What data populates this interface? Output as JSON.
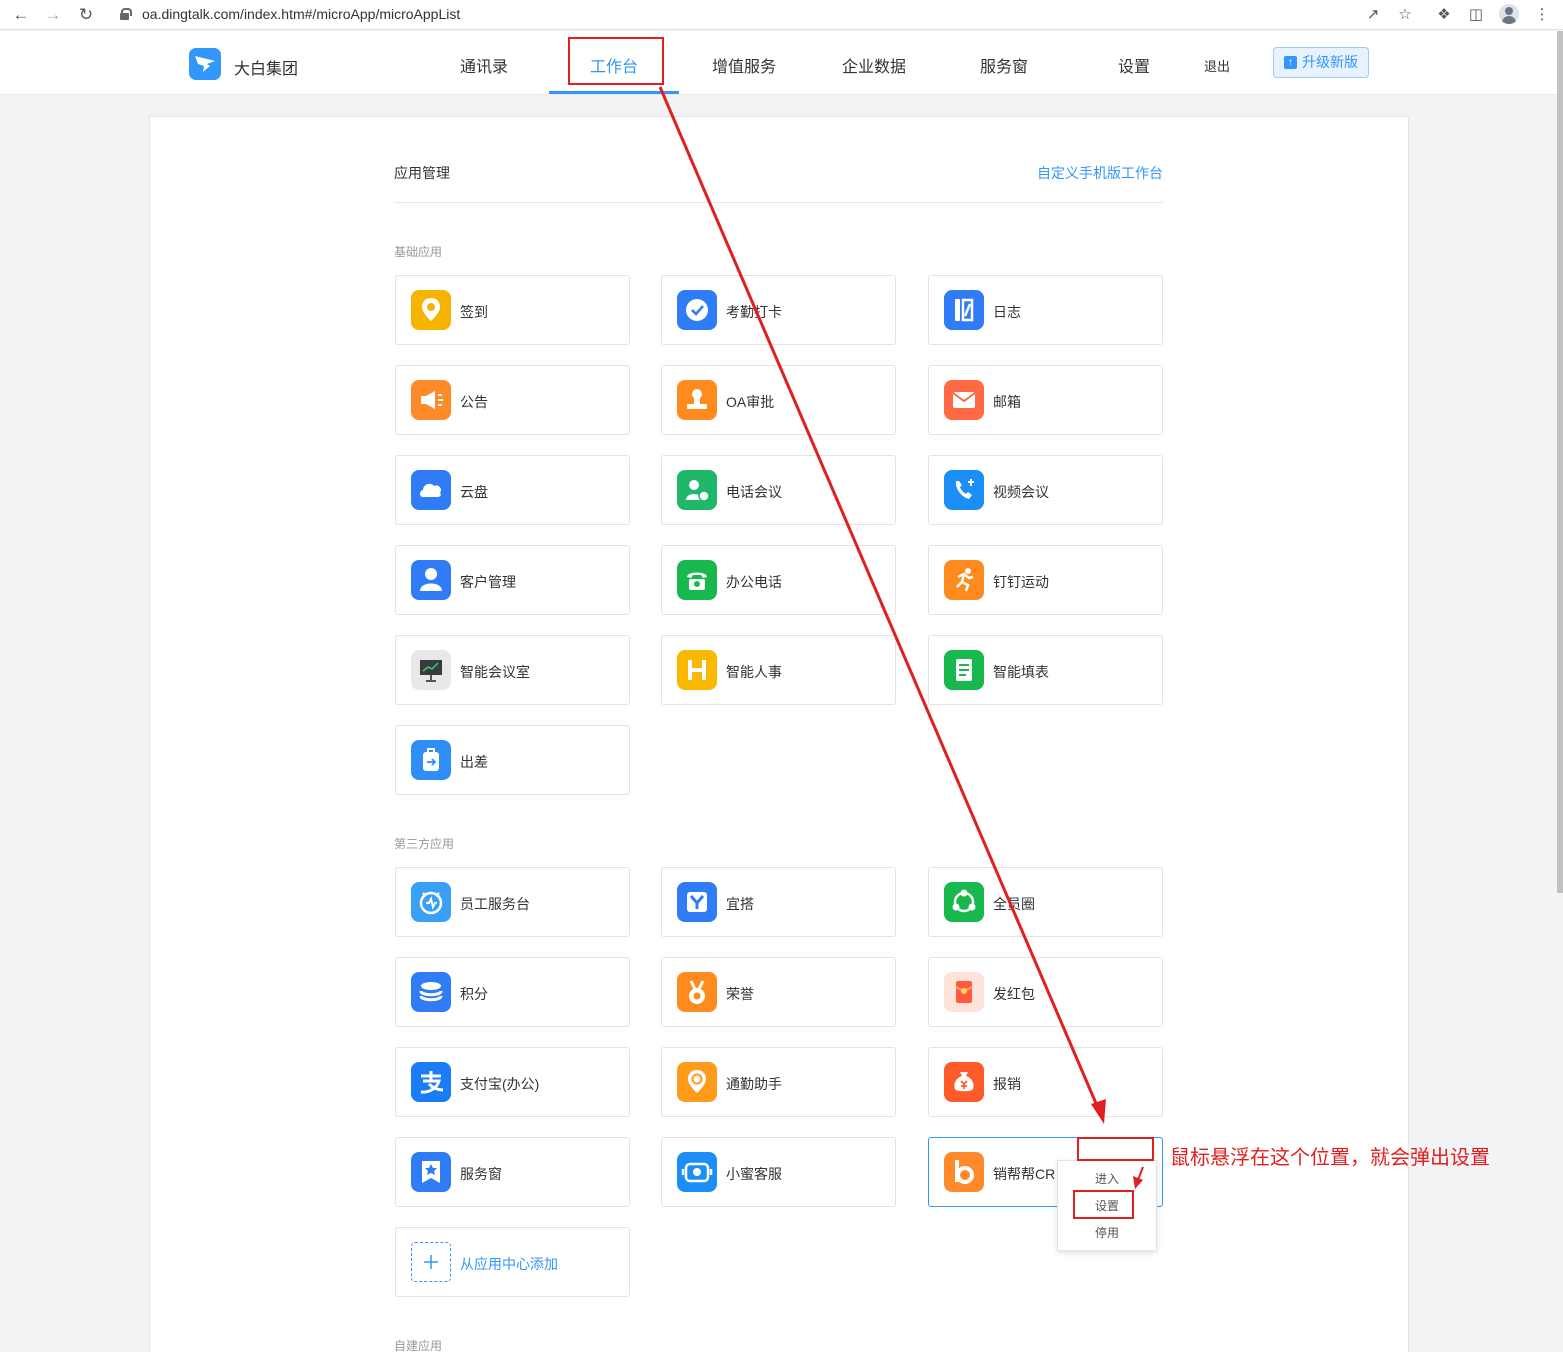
{
  "browser": {
    "url": "oa.dingtalk.com/index.htm#/microApp/microAppList"
  },
  "header": {
    "brand": "大白集团",
    "nav": [
      {
        "label": "通讯录",
        "active": false
      },
      {
        "label": "工作台",
        "active": true
      },
      {
        "label": "增值服务",
        "active": false
      },
      {
        "label": "企业数据",
        "active": false
      },
      {
        "label": "服务窗",
        "active": false
      },
      {
        "label": "设置",
        "active": false
      }
    ],
    "logout": "退出",
    "upgrade": "升级新版"
  },
  "page": {
    "title": "应用管理",
    "custom_link": "自定义手机版工作台"
  },
  "sections": {
    "basic": {
      "title": "基础应用",
      "apps": [
        {
          "name": "签到",
          "icon": "location-pin-icon",
          "color": "#f6b400"
        },
        {
          "name": "考勤打卡",
          "icon": "check-shield-icon",
          "color": "#2f7cf6"
        },
        {
          "name": "日志",
          "icon": "journal-icon",
          "color": "#2f7cf6"
        },
        {
          "name": "公告",
          "icon": "megaphone-icon",
          "color": "#ff8a2a"
        },
        {
          "name": "OA审批",
          "icon": "stamp-icon",
          "color": "#ff8a1e"
        },
        {
          "name": "邮箱",
          "icon": "mail-icon",
          "color": "#ff6a45"
        },
        {
          "name": "云盘",
          "icon": "cloud-icon",
          "color": "#2f7cf6"
        },
        {
          "name": "电话会议",
          "icon": "conference-call-icon",
          "color": "#1fb86a"
        },
        {
          "name": "视频会议",
          "icon": "video-call-icon",
          "color": "#1c8ff6"
        },
        {
          "name": "客户管理",
          "icon": "customer-icon",
          "color": "#2f7cf6"
        },
        {
          "name": "办公电话",
          "icon": "telephone-icon",
          "color": "#18b84e"
        },
        {
          "name": "钉钉运动",
          "icon": "running-icon",
          "color": "#ff8a1e"
        },
        {
          "name": "智能会议室",
          "icon": "presentation-icon",
          "color": "#e8e8ea"
        },
        {
          "name": "智能人事",
          "icon": "hr-icon",
          "color": "#fbb800"
        },
        {
          "name": "智能填表",
          "icon": "form-icon",
          "color": "#18b84e"
        },
        {
          "name": "出差",
          "icon": "luggage-icon",
          "color": "#2f8ef6"
        }
      ]
    },
    "third_party": {
      "title": "第三方应用",
      "apps": [
        {
          "name": "员工服务台",
          "icon": "service-desk-icon",
          "color": "#3aa0f6"
        },
        {
          "name": "宜搭",
          "icon": "yida-icon",
          "color": "#2f7cf6"
        },
        {
          "name": "全员圈",
          "icon": "circle-share-icon",
          "color": "#18b84e"
        },
        {
          "name": "积分",
          "icon": "coins-icon",
          "color": "#2f7cf6"
        },
        {
          "name": "荣誉",
          "icon": "medal-icon",
          "color": "#ff8a1e"
        },
        {
          "name": "发红包",
          "icon": "red-packet-icon",
          "color": "#fde3d8"
        },
        {
          "name": "支付宝(办公)",
          "icon": "alipay-icon",
          "color": "#1a7cf6"
        },
        {
          "name": "通勤助手",
          "icon": "commute-icon",
          "color": "#ff9a1a"
        },
        {
          "name": "报销",
          "icon": "money-bag-icon",
          "color": "#ff5a2a"
        },
        {
          "name": "服务窗",
          "icon": "service-window-icon",
          "color": "#2f7cf6"
        },
        {
          "name": "小蜜客服",
          "icon": "customer-service-icon",
          "color": "#1c8ff6"
        },
        {
          "name": "销帮帮CR",
          "icon": "xiaobangbang-icon",
          "color": "#ff8a2a"
        }
      ],
      "add_label": "从应用中心添加"
    },
    "custom": {
      "title": "自建应用"
    }
  },
  "context_menu": {
    "items": [
      "进入",
      "设置",
      "停用"
    ]
  },
  "annotation": {
    "text": "鼠标悬浮在这个位置，就会弹出设置"
  }
}
